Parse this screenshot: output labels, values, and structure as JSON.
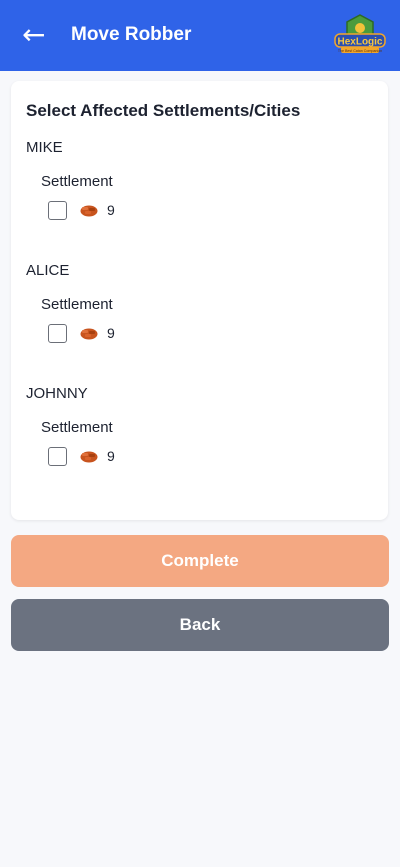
{
  "header": {
    "back_icon": "left-arrow-icon",
    "title": "Move Robber",
    "logo_text": "HexLogic",
    "logo_tagline": "The Best Catan Companion",
    "color": "#2f63e8"
  },
  "card": {
    "title": "Select Affected Settlements/Cities",
    "players": [
      {
        "name": "MIKE",
        "building": "Settlement",
        "resource_icon": "brick-icon",
        "number": "9",
        "checked": false
      },
      {
        "name": "ALICE",
        "building": "Settlement",
        "resource_icon": "brick-icon",
        "number": "9",
        "checked": false
      },
      {
        "name": "JOHNNY",
        "building": "Settlement",
        "resource_icon": "brick-icon",
        "number": "9",
        "checked": false
      }
    ]
  },
  "buttons": {
    "complete_label": "Complete",
    "complete_color": "#f4a882",
    "back_label": "Back",
    "back_color": "#6b7280"
  }
}
